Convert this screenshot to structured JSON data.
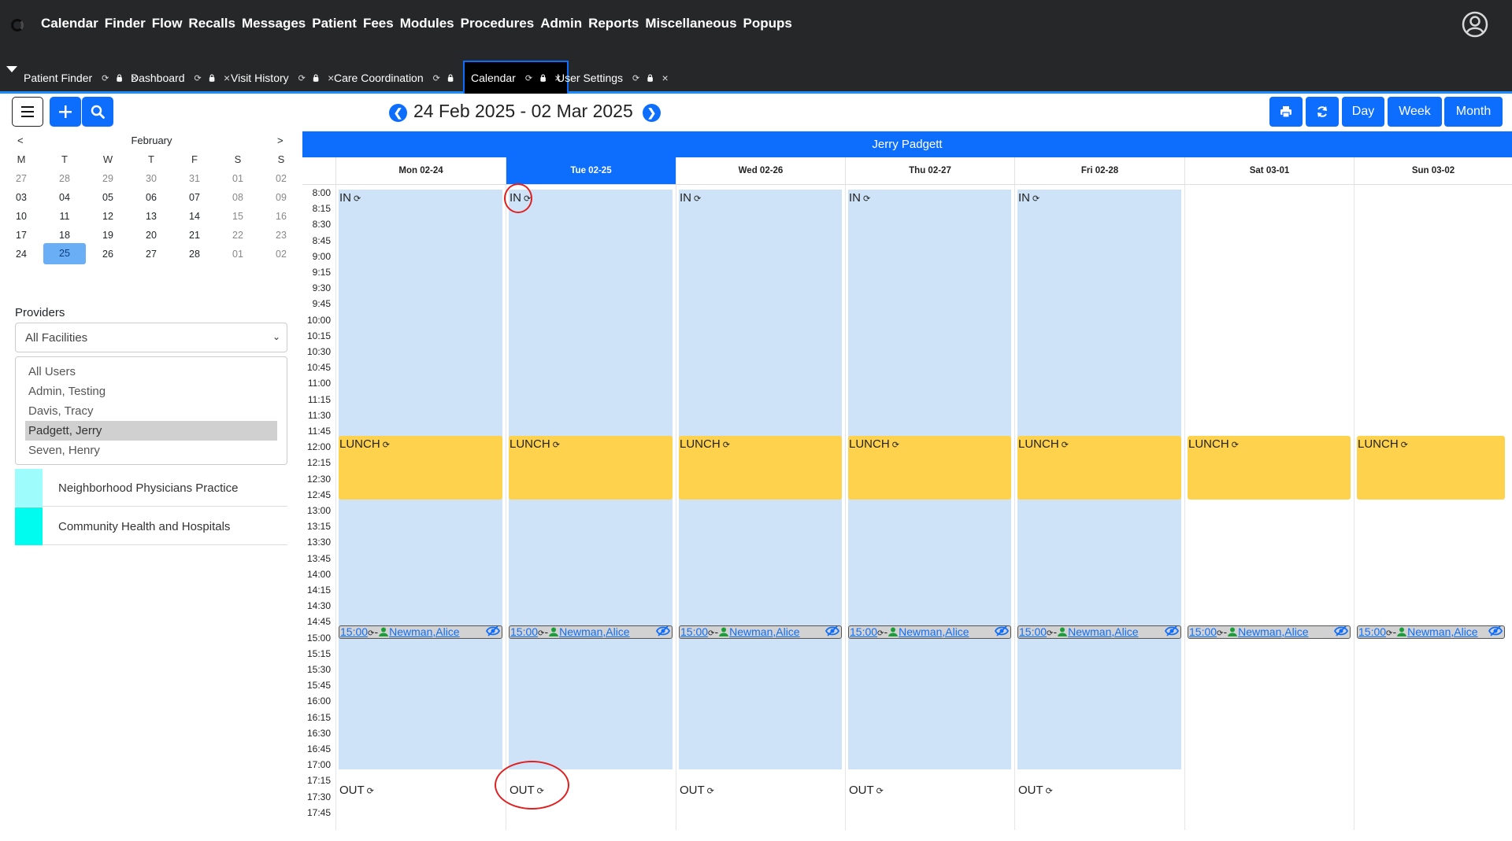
{
  "topbar": {
    "menu": [
      "Calendar",
      "Finder",
      "Flow",
      "Recalls",
      "Messages",
      "Patient",
      "Fees",
      "Modules",
      "Procedures",
      "Admin",
      "Reports",
      "Miscellaneous",
      "Popups"
    ],
    "icons": [
      "logo-icon",
      "user-circle-icon"
    ]
  },
  "tabs": [
    {
      "label": "Patient Finder",
      "active": false
    },
    {
      "label": "Dashboard",
      "active": false
    },
    {
      "label": "Visit History",
      "active": false
    },
    {
      "label": "Care Coordination",
      "active": false
    },
    {
      "label": "Calendar",
      "active": true
    },
    {
      "label": "User Settings",
      "active": false
    }
  ],
  "tab_icons": {
    "refresh": "⟳",
    "lock": "🔒",
    "close": "×"
  },
  "mini_calendar": {
    "prev": "<",
    "next": ">",
    "month": "February",
    "dow": [
      "M",
      "T",
      "W",
      "T",
      "F",
      "S",
      "S"
    ],
    "weeks": [
      [
        "27",
        "28",
        "29",
        "30",
        "31",
        "01",
        "02"
      ],
      [
        "03",
        "04",
        "05",
        "06",
        "07",
        "08",
        "09"
      ],
      [
        "10",
        "11",
        "12",
        "13",
        "14",
        "15",
        "16"
      ],
      [
        "17",
        "18",
        "19",
        "20",
        "21",
        "22",
        "23"
      ],
      [
        "24",
        "25",
        "26",
        "27",
        "28",
        "01",
        "02"
      ]
    ],
    "today": "25"
  },
  "providers": {
    "label": "Providers",
    "facility": "All Facilities",
    "users": [
      "All Users",
      "Admin, Testing",
      "Davis, Tracy",
      "Padgett, Jerry",
      "Seven, Henry"
    ],
    "selected_user": "Padgett, Jerry"
  },
  "facilities": [
    {
      "name": "Neighborhood Physicians Practice",
      "color": "#9ffcfc"
    },
    {
      "name": "Community Health and Hospitals",
      "color": "#00fcef"
    }
  ],
  "toolbar": {
    "range_title": "24 Feb 2025 - 02 Mar 2025",
    "day": "Day",
    "week": "Week",
    "month": "Month"
  },
  "provider_name": "Jerry Padgett",
  "days": [
    "Mon 02-24",
    "Tue 02-25",
    "Wed 02-26",
    "Thu 02-27",
    "Fri 02-28",
    "Sat 03-01",
    "Sun 03-02"
  ],
  "active_day": "Tue 02-25",
  "times": [
    "8:00",
    "8:15",
    "8:30",
    "8:45",
    "9:00",
    "9:15",
    "9:30",
    "9:45",
    "10:00",
    "10:15",
    "10:30",
    "10:45",
    "11:00",
    "11:15",
    "11:30",
    "11:45",
    "12:00",
    "12:15",
    "12:30",
    "12:45",
    "13:00",
    "13:15",
    "13:30",
    "13:45",
    "14:00",
    "14:15",
    "14:30",
    "14:45",
    "15:00",
    "15:15",
    "15:30",
    "15:45",
    "16:00",
    "16:15",
    "16:30",
    "16:45",
    "17:00",
    "17:15",
    "17:30",
    "17:45"
  ],
  "events": {
    "in_label": "IN",
    "out_label": "OUT",
    "lunch_label": "LUNCH",
    "appt_time": "15:00",
    "appt_sep": "-",
    "appt_patient": "Newman,Alice"
  },
  "colors": {
    "accent": "#0d6efd",
    "in_block": "#cfe3f8",
    "lunch": "#ffd24d",
    "highlight_circle": "#e02020"
  }
}
